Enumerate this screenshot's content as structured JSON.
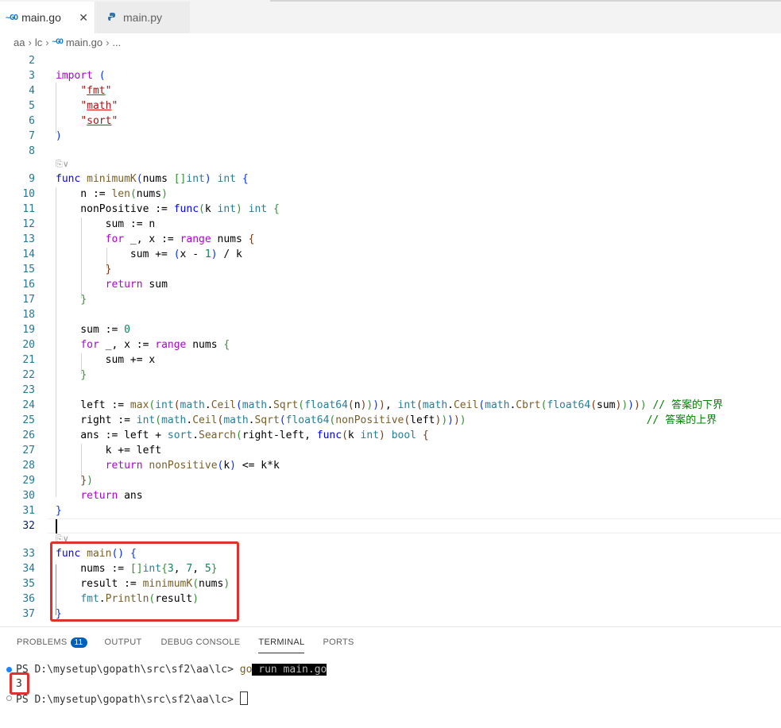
{
  "tabs": [
    {
      "icon": "go-file-icon",
      "icon_text": "~GO",
      "label": "main.go",
      "active": true,
      "close": "✕"
    },
    {
      "icon": "python-file-icon",
      "label": "main.py",
      "active": false
    }
  ],
  "breadcrumb": {
    "parts": [
      "aa",
      "lc",
      "main.go",
      "..."
    ],
    "go_icon_text": "~GO"
  },
  "editor": {
    "line_numbers": [
      "2",
      "3",
      "4",
      "5",
      "6",
      "7",
      "8",
      "9",
      "10",
      "11",
      "12",
      "13",
      "14",
      "15",
      "16",
      "17",
      "18",
      "19",
      "20",
      "21",
      "22",
      "23",
      "24",
      "25",
      "26",
      "27",
      "28",
      "29",
      "30",
      "31",
      "32",
      "33",
      "34",
      "35",
      "36",
      "37"
    ],
    "codelens": "⎘∨",
    "comment_lower": "// 答案的下界",
    "comment_upper": "// 答案的上界",
    "current_line": "32"
  },
  "panel": {
    "tabs": [
      "PROBLEMS",
      "OUTPUT",
      "DEBUG CONSOLE",
      "TERMINAL",
      "PORTS"
    ],
    "active_tab": "TERMINAL",
    "problems_count": "11"
  },
  "terminal": {
    "prompt": "PS D:\\mysetup\\gopath\\src\\sf2\\aa\\lc> ",
    "cmd_go": "go",
    "cmd_rest": " run main.go",
    "output": "3",
    "prompt2": "PS D:\\mysetup\\gopath\\src\\sf2\\aa\\lc> "
  },
  "colors": {
    "accent": "#005fb8",
    "highlight_box": "#e03131",
    "keyword": "#af00db",
    "comment": "#008000"
  }
}
